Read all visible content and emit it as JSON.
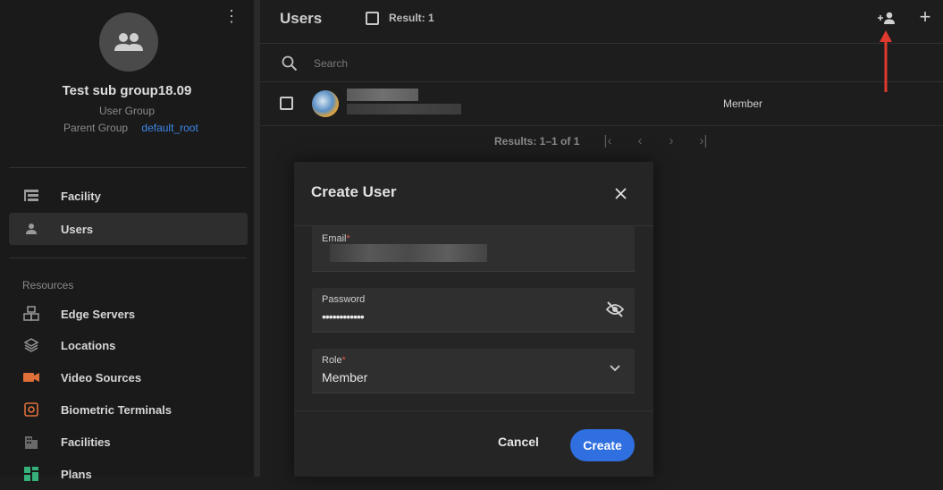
{
  "sidebar": {
    "group_name": "Test sub group18.09",
    "group_type": "User Group",
    "parent_label": "Parent Group",
    "parent_value": "default_root",
    "nav": [
      {
        "label": "Facility",
        "icon": "tree-icon"
      },
      {
        "label": "Users",
        "icon": "person-icon",
        "active": true
      }
    ],
    "resources_label": "Resources",
    "resources": [
      {
        "label": "Edge Servers",
        "icon": "edge-server-icon"
      },
      {
        "label": "Locations",
        "icon": "layers-icon"
      },
      {
        "label": "Video Sources",
        "icon": "video-camera-icon",
        "color": "#e0703a"
      },
      {
        "label": "Biometric Terminals",
        "icon": "terminal-icon",
        "color": "#e0703a"
      },
      {
        "label": "Facilities",
        "icon": "building-icon"
      },
      {
        "label": "Plans",
        "icon": "plans-icon",
        "color": "#35b07a"
      }
    ]
  },
  "main": {
    "title": "Users",
    "result": "Result: 1",
    "search_placeholder": "Search",
    "rows": [
      {
        "role": "Member"
      }
    ],
    "pager": "Results: 1–1 of 1"
  },
  "dialog": {
    "title": "Create User",
    "email_label": "Email",
    "password_label": "Password",
    "password_value": "••••••••••••",
    "role_label": "Role",
    "role_value": "Member",
    "cancel": "Cancel",
    "create": "Create"
  },
  "colors": {
    "accent": "#2f6fe0",
    "link": "#3d87e8",
    "annotation": "#e03a2f",
    "required": "#d9534f"
  }
}
